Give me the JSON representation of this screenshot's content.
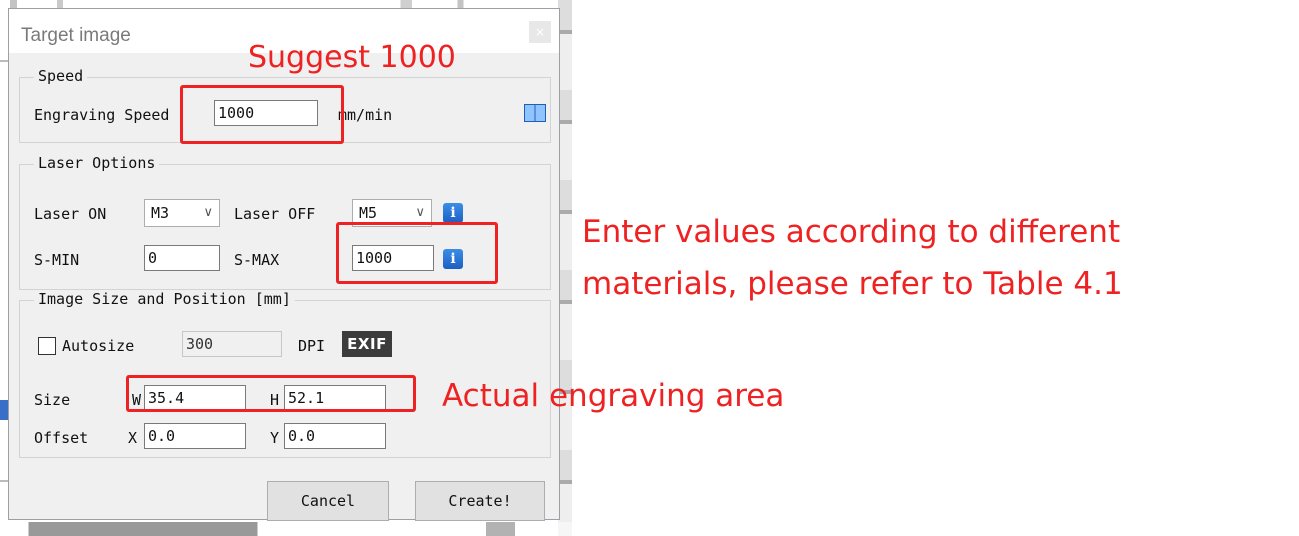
{
  "dialog": {
    "title": "Target image",
    "close_label": "×"
  },
  "speed": {
    "legend": "Speed",
    "engraving_label": "Engraving Speed",
    "engraving_value": "1000",
    "unit": "mm/min"
  },
  "laser": {
    "legend": "Laser Options",
    "on_label": "Laser ON",
    "on_value": "M3",
    "off_label": "Laser OFF",
    "off_value": "M5",
    "smin_label": "S-MIN",
    "smin_value": "0",
    "smax_label": "S-MAX",
    "smax_value": "1000",
    "info_glyph": "i"
  },
  "image": {
    "legend": "Image Size and Position [mm]",
    "autosize_label": "Autosize",
    "autosize_checked": false,
    "dpi_value": "300",
    "dpi_label": "DPI",
    "exif_label": "EXIF",
    "size_label": "Size",
    "w_label": "W",
    "w_value": "35.4",
    "h_label": "H",
    "h_value": "52.1",
    "offset_label": "Offset",
    "x_label": "X",
    "x_value": "0.0",
    "y_label": "Y",
    "y_value": "0.0"
  },
  "buttons": {
    "cancel": "Cancel",
    "create": "Create!"
  },
  "annotations": {
    "suggest": "Suggest 1000",
    "materials_line1": "Enter values according to different",
    "materials_line2": "materials, please refer to Table 4.1",
    "area": "Actual engraving area",
    "color": "#ee2222"
  },
  "icons": {
    "chevron": "∨"
  }
}
